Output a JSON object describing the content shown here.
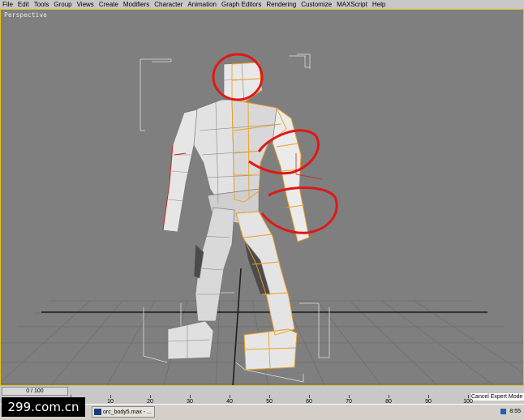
{
  "menubar": {
    "items": [
      "File",
      "Edit",
      "Tools",
      "Group",
      "Views",
      "Create",
      "Modifiers",
      "Character",
      "Animation",
      "Graph Editors",
      "Rendering",
      "Customize",
      "MAXScript",
      "Help"
    ]
  },
  "viewport": {
    "label": "Perspective",
    "border_color": "#e0c21a",
    "bg_color": "#7f7f7f",
    "selection_color": "#f0a020",
    "markup_color": "#e01818"
  },
  "timeslider": {
    "text": "0 / 100"
  },
  "ruler": {
    "ticks": [
      "0",
      "10",
      "20",
      "30",
      "40",
      "50",
      "60",
      "70",
      "80",
      "90",
      "100"
    ]
  },
  "prompt": {
    "text": "Cancel Expert Mode"
  },
  "taskbar": {
    "task_label": "orc_body5.max - ...",
    "clock": "8:55"
  },
  "watermark": {
    "text": "299.com.cn"
  }
}
